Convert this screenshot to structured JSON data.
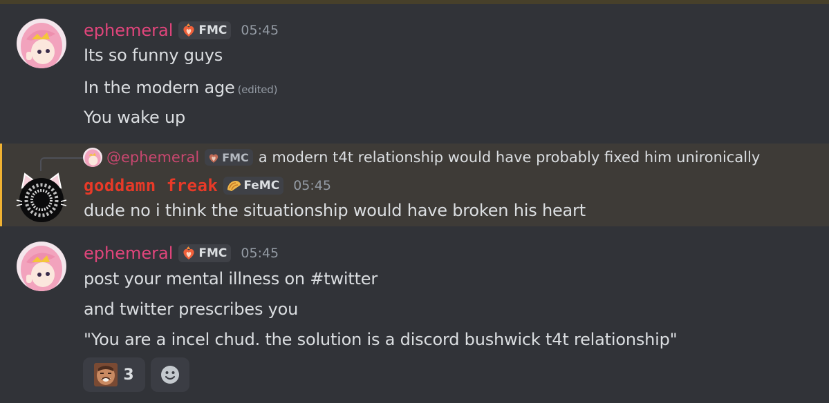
{
  "colors": {
    "user_ephemeral": "#e0457b",
    "user_goddamn": "#e83a28",
    "highlight_bg": "#3e3b37",
    "mention_bar": "#f0b232"
  },
  "messages": [
    {
      "username": "ephemeral",
      "tag": "FMC",
      "tag_icon": "fire-heart-icon",
      "time": "05:45",
      "lines": [
        "Its so funny guys",
        "In the modern age",
        "You wake up"
      ],
      "edited_label": "(edited)"
    },
    {
      "reply": {
        "mention": "@ephemeral",
        "tag": "FMC",
        "text": "a modern t4t relationship would have probably fixed him unironically"
      },
      "username": "goddamn freak",
      "tag": "FeMC",
      "tag_icon": "taco-icon",
      "time": "05:45",
      "lines": [
        "dude no i think the situationship would have broken his heart"
      ]
    },
    {
      "username": "ephemeral",
      "tag": "FMC",
      "tag_icon": "fire-heart-icon",
      "time": "05:45",
      "lines": [
        "post your mental illness on #twitter",
        "and twitter prescribes you",
        "\"You are a incel chud. the solution is a discord bushwick t4t relationship\""
      ]
    }
  ],
  "reactions": [
    {
      "emoji": "laughing-face-emoji",
      "count": "3"
    },
    {
      "emoji": "add-reaction-icon"
    }
  ]
}
